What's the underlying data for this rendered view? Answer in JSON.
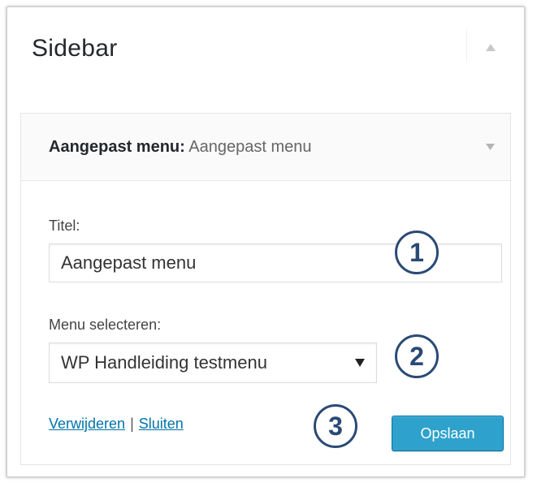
{
  "sidebar": {
    "title": "Sidebar",
    "collapse_icon": "triangle-up-icon"
  },
  "widget": {
    "type_label": "Aangepast menu:",
    "instance_title": "Aangepast menu",
    "toggle_icon": "triangle-down-icon",
    "title_field": {
      "label": "Titel:",
      "value": "Aangepast menu"
    },
    "menu_field": {
      "label": "Menu selecteren:",
      "selected": "WP Handleiding testmenu"
    },
    "actions": {
      "delete_label": "Verwijderen",
      "separator": "|",
      "close_label": "Sluiten",
      "save_label": "Opslaan"
    }
  },
  "annotations": [
    "1",
    "2",
    "3"
  ],
  "colors": {
    "accent": "#2ea2cc",
    "link": "#0073aa",
    "badge": "#2a4a74"
  }
}
